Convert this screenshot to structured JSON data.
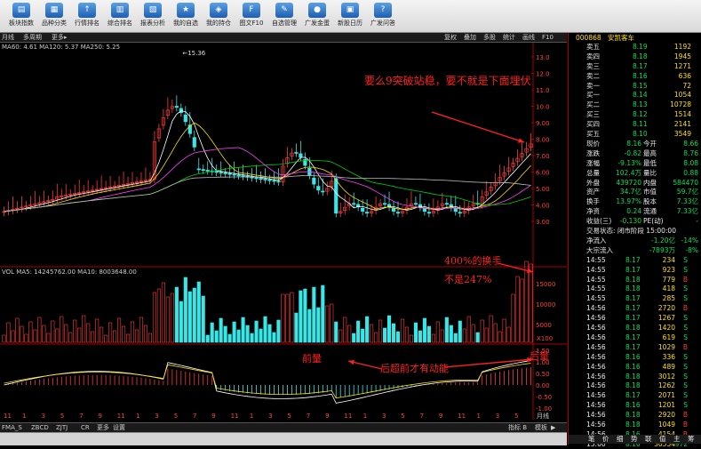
{
  "toolbar": {
    "items": [
      {
        "label": "板块指数",
        "icon": "▤"
      },
      {
        "label": "品种分类",
        "icon": "▦"
      },
      {
        "label": "行情排名",
        "icon": "↑"
      },
      {
        "label": "综合排名",
        "icon": "▥"
      },
      {
        "label": "报表分析",
        "icon": "▧"
      },
      {
        "label": "我的自选",
        "icon": "★"
      },
      {
        "label": "我的持仓",
        "icon": "◈"
      },
      {
        "label": "图文F10",
        "icon": "F"
      },
      {
        "label": "自选管理",
        "icon": "✎"
      },
      {
        "label": "广发金蛋",
        "icon": "●"
      },
      {
        "label": "新股日历",
        "icon": "▣"
      },
      {
        "label": "广发问答",
        "icon": "?"
      }
    ]
  },
  "tabbar": {
    "left": [
      "月线",
      "多周期",
      "更多▸"
    ],
    "right": [
      "复权",
      "叠加",
      "多股",
      "统计",
      "画线",
      "F10",
      "标记",
      "-",
      "+"
    ]
  },
  "price_panel": {
    "ma_readout": "MA60: 4.61  MA120: 5.37  MA250: 5.25",
    "max_label": "15.36",
    "y_ticks": [
      "13.0",
      "12.0",
      "11.0",
      "10.0",
      "9.00",
      "8.00",
      "7.00",
      "6.00",
      "5.00",
      "4.00",
      "3.00"
    ]
  },
  "volume_panel": {
    "readout": "VOL MA5: 14245762.00  MA10: 8003648.00",
    "y_ticks": [
      "15000",
      "10000",
      "5000"
    ],
    "unit": "X100"
  },
  "macd_panel": {
    "y_ticks": [
      "1.50",
      "1.00",
      "0.50",
      "0.00",
      "-0.50",
      "-1.00"
    ],
    "x_ticks": [
      "11",
      "1",
      "3",
      "5",
      "7",
      "9",
      "11",
      "1",
      "3",
      "5",
      "7",
      "9",
      "11",
      "1",
      "3",
      "5",
      "7",
      "9",
      "11",
      "1",
      "3",
      "5",
      "7",
      "9",
      "11",
      "1",
      "3",
      "5"
    ],
    "period_label": "月线"
  },
  "annotations": {
    "top": "要么9突破站稳，要不就是下面埋伏",
    "mid1": "400%的换手",
    "mid2": "不是247%",
    "left": "前量",
    "center": "后超前才有动能",
    "right": "后量"
  },
  "bottom_tabs": [
    "FMA_S",
    "ZBCD",
    "ZJTJ",
    "CR",
    "更多",
    "设置"
  ],
  "bottom_right_tabs": [
    "指标 B",
    "模板",
    "▶"
  ],
  "quote": {
    "code": "000868",
    "name": "安凯客车",
    "asks": [
      {
        "label": "卖五",
        "price": "8.19",
        "vol": "1192"
      },
      {
        "label": "卖四",
        "price": "8.18",
        "vol": "1945"
      },
      {
        "label": "卖三",
        "price": "8.17",
        "vol": "1271"
      },
      {
        "label": "卖二",
        "price": "8.16",
        "vol": "636"
      },
      {
        "label": "卖一",
        "price": "8.15",
        "vol": "72"
      }
    ],
    "bids": [
      {
        "label": "买一",
        "price": "8.14",
        "vol": "1054"
      },
      {
        "label": "买二",
        "price": "8.13",
        "vol": "10728"
      },
      {
        "label": "买三",
        "price": "8.12",
        "vol": "1514"
      },
      {
        "label": "买四",
        "price": "8.11",
        "vol": "2141"
      },
      {
        "label": "买五",
        "price": "8.10",
        "vol": "3549"
      }
    ],
    "stats": [
      {
        "a": "现价",
        "b": "8.16",
        "c": "今开",
        "d": "8.66"
      },
      {
        "a": "涨跌",
        "b": "-0.82",
        "c": "最高",
        "d": "8.76"
      },
      {
        "a": "涨幅",
        "b": "-9.13%",
        "c": "最低",
        "d": "8.08"
      },
      {
        "a": "总量",
        "b": "102.4万",
        "c": "量比",
        "d": "0.88"
      },
      {
        "a": "外盘",
        "b": "439720",
        "c": "内盘",
        "d": "584470"
      },
      {
        "a": "资产",
        "b": "34.7亿",
        "c": "市值",
        "d": "59.7亿"
      },
      {
        "a": "换手",
        "b": "13.97%",
        "c": "股本",
        "d": "7.33亿"
      },
      {
        "a": "净资",
        "b": "0.24",
        "c": "流通",
        "d": "7.33亿"
      },
      {
        "a": "收益(三)",
        "b": "-0.130",
        "c": "PE(动)",
        "d": "-"
      }
    ],
    "status_line": "交易状态: 闭市阶段 15:00:00",
    "flows": [
      {
        "label": "净流入",
        "v1": "-1.20亿",
        "v2": "-14%"
      },
      {
        "label": "大宗流入",
        "v1": "-7893万",
        "v2": "-8%"
      }
    ],
    "ticks": [
      {
        "t": "14:55",
        "p": "8.17",
        "v": "234",
        "s": "S"
      },
      {
        "t": "14:55",
        "p": "8.17",
        "v": "923",
        "s": "S"
      },
      {
        "t": "14:55",
        "p": "8.18",
        "v": "779",
        "s": "B"
      },
      {
        "t": "14:55",
        "p": "8.18",
        "v": "418",
        "s": "S"
      },
      {
        "t": "14:55",
        "p": "8.17",
        "v": "285",
        "s": "S"
      },
      {
        "t": "14:56",
        "p": "8.17",
        "v": "2720",
        "s": "B"
      },
      {
        "t": "14:56",
        "p": "8.17",
        "v": "1267",
        "s": "S"
      },
      {
        "t": "14:56",
        "p": "8.18",
        "v": "1420",
        "s": "S"
      },
      {
        "t": "14:56",
        "p": "8.17",
        "v": "619",
        "s": "S"
      },
      {
        "t": "14:56",
        "p": "8.17",
        "v": "1029",
        "s": "B"
      },
      {
        "t": "14:56",
        "p": "8.16",
        "v": "336",
        "s": "S"
      },
      {
        "t": "14:56",
        "p": "8.16",
        "v": "489",
        "s": "S"
      },
      {
        "t": "14:56",
        "p": "8.18",
        "v": "3012",
        "s": "S"
      },
      {
        "t": "14:56",
        "p": "8.18",
        "v": "1262",
        "s": "S"
      },
      {
        "t": "14:56",
        "p": "8.17",
        "v": "2071",
        "s": "S"
      },
      {
        "t": "14:56",
        "p": "8.16",
        "v": "1201",
        "s": "S"
      },
      {
        "t": "14:56",
        "p": "8.18",
        "v": "2920",
        "s": "B"
      },
      {
        "t": "14:56",
        "p": "8.18",
        "v": "1049",
        "s": "B"
      },
      {
        "t": "14:56",
        "p": "8.16",
        "v": "4154",
        "s": "B"
      },
      {
        "t": "15:00",
        "p": "8.16",
        "v": "30554",
        "s": "972"
      }
    ],
    "footer_tabs": [
      "笔",
      "价",
      "细",
      "势",
      "联",
      "值",
      "主",
      "筹"
    ]
  },
  "colors": {
    "up": "#ff3b3b",
    "down": "#38e8e8",
    "ma1": "#ffffff",
    "ma2": "#ffe000",
    "ma3": "#ff40ff",
    "ma4": "#00d000"
  }
}
